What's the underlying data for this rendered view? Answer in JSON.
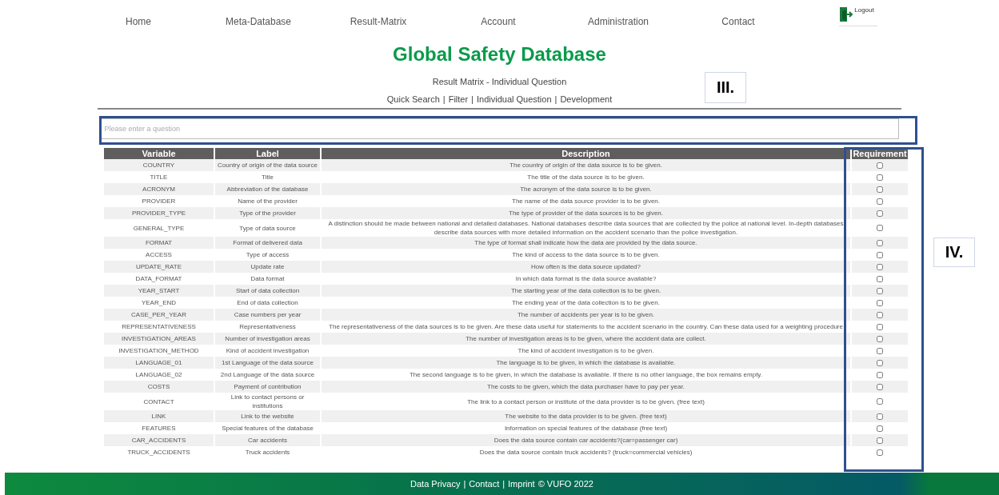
{
  "nav": {
    "items": [
      "Home",
      "Meta-Database",
      "Result-Matrix",
      "Account",
      "Administration",
      "Contact"
    ],
    "logout": "Logout"
  },
  "title": "Global Safety Database",
  "subtitle": "Result Matrix - Individual Question",
  "sub_links": [
    "Quick Search",
    "Filter",
    "Individual Question",
    "Development"
  ],
  "sub_link_separator": "|",
  "search": {
    "placeholder": "Please enter a question"
  },
  "table": {
    "columns": [
      "Variable",
      "Label",
      "Description",
      "Requirement"
    ],
    "rows": [
      {
        "variable": "COUNTRY",
        "label": "Country of origin of the data source",
        "description": "The country of origin of the data source is to be given.",
        "checked": false
      },
      {
        "variable": "TITLE",
        "label": "Title",
        "description": "The title of the data source is to be given.",
        "checked": false
      },
      {
        "variable": "ACRONYM",
        "label": "Abbreviation of the database",
        "description": "The acronym of the data source is to be given.",
        "checked": false
      },
      {
        "variable": "PROVIDER",
        "label": "Name of the provider",
        "description": "The name of the data source provider is to be given.",
        "checked": false
      },
      {
        "variable": "PROVIDER_TYPE",
        "label": "Type of the provider",
        "description": "The type of provider of the data sources is to be given.",
        "checked": false
      },
      {
        "variable": "GENERAL_TYPE",
        "label": "Type of data source",
        "description": "A distinction should be made between national and detailed databases. National databases describe data sources that are collected by the police at national level. In-depth databases describe data sources with more detailed information on the accident scenario than the police investigation.",
        "checked": false
      },
      {
        "variable": "FORMAT",
        "label": "Format of delivered data",
        "description": "The type of format shall indicate how the data are provided by the data source.",
        "checked": false
      },
      {
        "variable": "ACCESS",
        "label": "Type of access",
        "description": "The kind of access to the data source is to be given.",
        "checked": false
      },
      {
        "variable": "UPDATE_RATE",
        "label": "Update rate",
        "description": "How often is the data source updated?",
        "checked": false
      },
      {
        "variable": "DATA_FORMAT",
        "label": "Data format",
        "description": "In which data format is the data source available?",
        "checked": false
      },
      {
        "variable": "YEAR_START",
        "label": "Start of data collection",
        "description": "The starting year of the data collection is to be given.",
        "checked": false
      },
      {
        "variable": "YEAR_END",
        "label": "End of data collection",
        "description": "The ending year of the data collection is to be given.",
        "checked": false
      },
      {
        "variable": "CASE_PER_YEAR",
        "label": "Case numbers per year",
        "description": "The number of accidents per year is to be given.",
        "checked": false
      },
      {
        "variable": "REPRESENTATIVENESS",
        "label": "Representativeness",
        "description": "The representativeness of the data sources is to be given. Are these data useful for statements to the accident scenario in the country. Can these data used for a weighting procedure",
        "checked": false
      },
      {
        "variable": "INVESTIGATION_AREAS",
        "label": "Number of investigation areas",
        "description": "The number of investigation areas is to be given, where the accident data are collect.",
        "checked": false
      },
      {
        "variable": "INVESTIGATION_METHOD",
        "label": "Kind of accident investigation",
        "description": "The kind of accident investigation is to be given.",
        "checked": false
      },
      {
        "variable": "LANGUAGE_01",
        "label": "1st Language of the data source",
        "description": "The language is to be given, in which the database is available.",
        "checked": false
      },
      {
        "variable": "LANGUAGE_02",
        "label": "2nd Language of the data source",
        "description": "The second language is to be given, in which the database is available. If there is no other language, the box remains empty.",
        "checked": false
      },
      {
        "variable": "COSTS",
        "label": "Payment of contribution",
        "description": "The costs to be given, which the data purchaser have to pay per year.",
        "checked": false
      },
      {
        "variable": "CONTACT",
        "label": "Link to contact persons or institutions",
        "description": "The link to a contact person or institute of the data provider is to be given. (free text)",
        "checked": false
      },
      {
        "variable": "LINK",
        "label": "Link to the website",
        "description": "The website to the data provider is to be given. (free text)",
        "checked": false
      },
      {
        "variable": "FEATURES",
        "label": "Special features of the database",
        "description": "Information on special features of the database (free text)",
        "checked": false
      },
      {
        "variable": "CAR_ACCIDENTS",
        "label": "Car accidents",
        "description": "Does the data source contain car accidents?(car=passenger car)",
        "checked": false
      },
      {
        "variable": "TRUCK_ACCIDENTS",
        "label": "Truck accidents",
        "description": "Does the data source contain truck accidents? (truck=commercial vehicles)",
        "checked": false
      }
    ]
  },
  "footer": {
    "links": [
      "Data Privacy",
      "Contact",
      "Imprint"
    ],
    "separator": "|",
    "copyright": "© VUFO 2022"
  },
  "annotations": [
    "III.",
    "IV."
  ]
}
